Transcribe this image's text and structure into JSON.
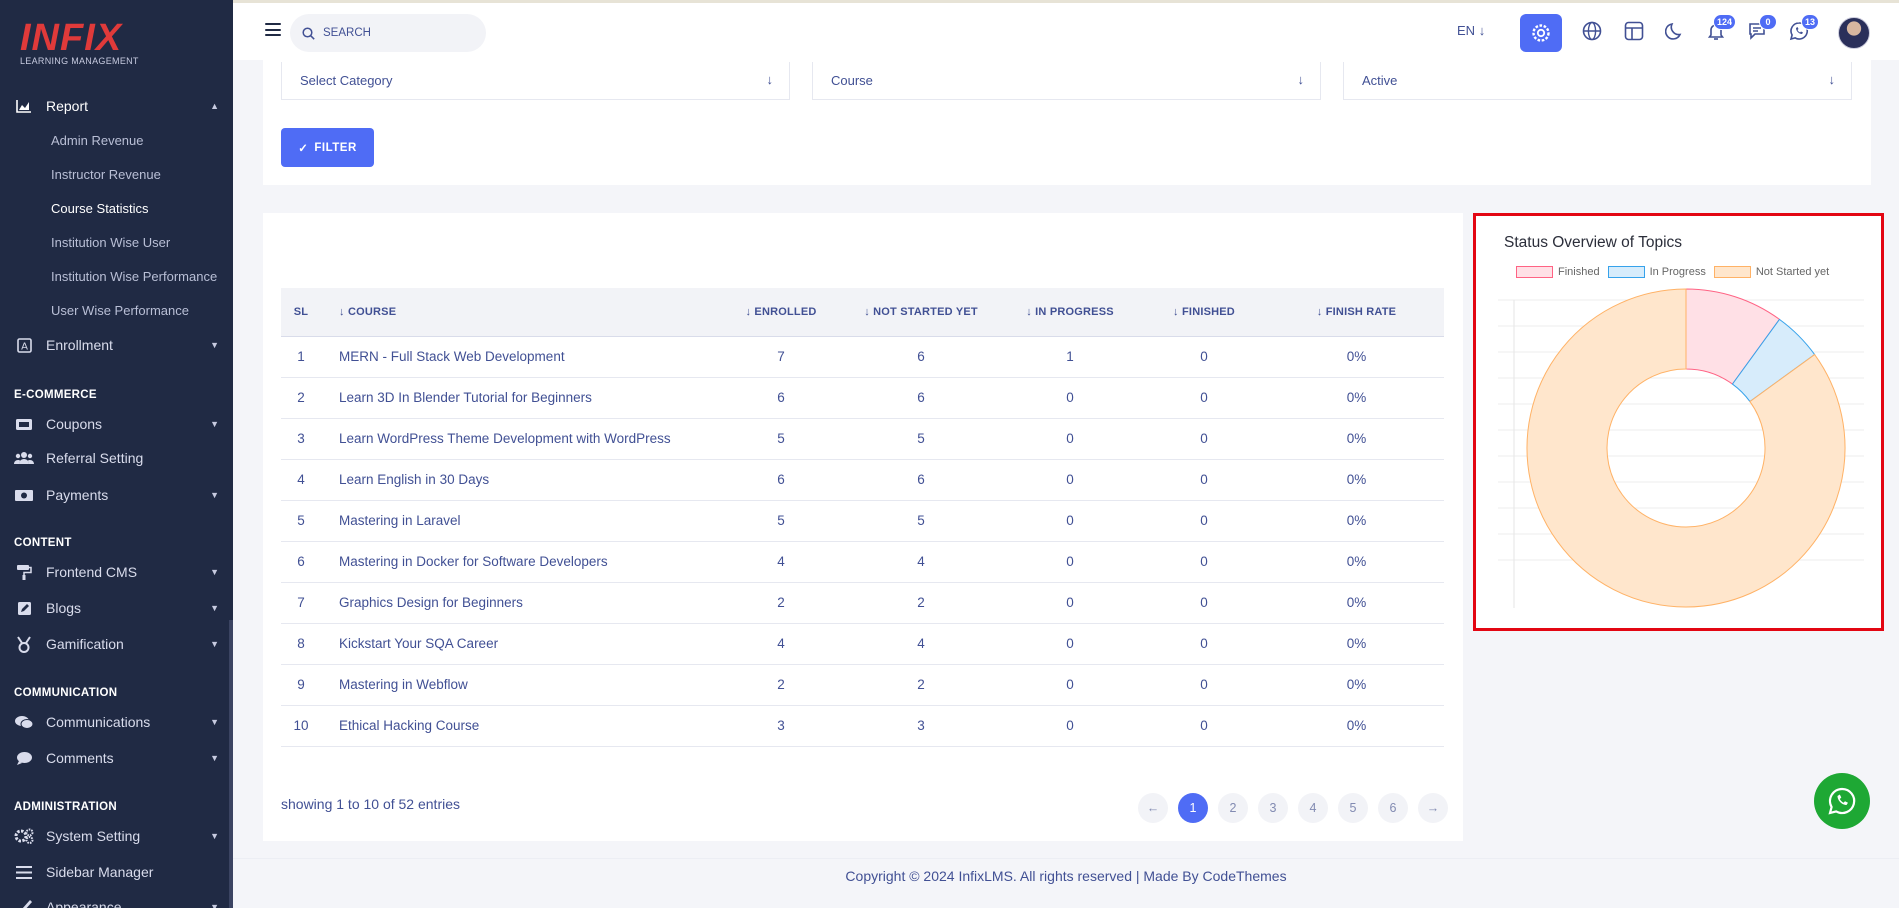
{
  "sidebar": {
    "logo_brand": "INFIX",
    "logo_tag": "LEARNING MANAGEMENT",
    "report_label": "Report",
    "report_sub": [
      "Admin Revenue",
      "Instructor Revenue",
      "Course Statistics",
      "Institution Wise User",
      "Institution Wise Performance",
      "User Wise Performance"
    ],
    "enrollment_label": "Enrollment",
    "sections": {
      "ecommerce": "E-COMMERCE",
      "content": "CONTENT",
      "communication": "COMMUNICATION",
      "administration": "ADMINISTRATION"
    },
    "coupons": "Coupons",
    "referral": "Referral Setting",
    "payments": "Payments",
    "frontend_cms": "Frontend CMS",
    "blogs": "Blogs",
    "gamification": "Gamification",
    "communications": "Communications",
    "comments": "Comments",
    "system_setting": "System Setting",
    "sidebar_manager": "Sidebar Manager",
    "appearance": "Appearance"
  },
  "topbar": {
    "search_placeholder": "SEARCH",
    "lang": "EN",
    "notif_count": "124",
    "msg_count": "0",
    "wa_count": "13"
  },
  "filters": {
    "category": "Select Category",
    "course": "Course",
    "status": "Active",
    "filter_button": "FILTER"
  },
  "table": {
    "headers": [
      "SL",
      "COURSE",
      "ENROLLED",
      "NOT STARTED YET",
      "IN PROGRESS",
      "FINISHED",
      "FINISH RATE"
    ],
    "rows": [
      [
        "1",
        "MERN - Full Stack Web Development",
        "7",
        "6",
        "1",
        "0",
        "0%"
      ],
      [
        "2",
        "Learn 3D In Blender Tutorial for Beginners",
        "6",
        "6",
        "0",
        "0",
        "0%"
      ],
      [
        "3",
        "Learn WordPress Theme Development with WordPress",
        "5",
        "5",
        "0",
        "0",
        "0%"
      ],
      [
        "4",
        "Learn English in 30 Days",
        "6",
        "6",
        "0",
        "0",
        "0%"
      ],
      [
        "5",
        "Mastering in Laravel",
        "5",
        "5",
        "0",
        "0",
        "0%"
      ],
      [
        "6",
        "Mastering in Docker for Software Developers",
        "4",
        "4",
        "0",
        "0",
        "0%"
      ],
      [
        "7",
        "Graphics Design for Beginners",
        "2",
        "2",
        "0",
        "0",
        "0%"
      ],
      [
        "8",
        "Kickstart Your SQA Career",
        "4",
        "4",
        "0",
        "0",
        "0%"
      ],
      [
        "9",
        "Mastering in Webflow",
        "2",
        "2",
        "0",
        "0",
        "0%"
      ],
      [
        "10",
        "Ethical Hacking Course",
        "3",
        "3",
        "0",
        "0",
        "0%"
      ]
    ],
    "showing": "showing 1 to 10 of 52 entries",
    "pages": [
      "1",
      "2",
      "3",
      "4",
      "5",
      "6"
    ],
    "current_page": "1"
  },
  "chart_data": {
    "type": "pie",
    "title": "Status Overview of Topics",
    "legend_position": "top",
    "categories": [
      "Finished",
      "In Progress",
      "Not Started yet"
    ],
    "values": [
      10,
      5,
      85
    ],
    "colors": {
      "Finished": {
        "fill": "#ffe0e6",
        "stroke": "#ff6384"
      },
      "In Progress": {
        "fill": "#d7ecfb",
        "stroke": "#36a2eb"
      },
      "Not Started yet": {
        "fill": "#ffe6cc",
        "stroke": "#ffb266"
      }
    },
    "donut": true
  },
  "footer": {
    "copyright": "Copyright © 2024 InfixLMS. All rights reserved | Made By CodeThemes"
  },
  "colors": {
    "sidebar_bg": "#202a44",
    "accent": "#4f6cf5",
    "text": "#415094",
    "highlight_border": "#e30613",
    "whatsapp": "#1ea834"
  }
}
